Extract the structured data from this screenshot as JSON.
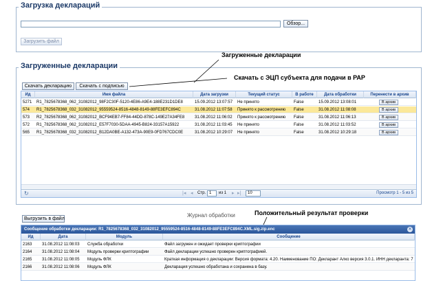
{
  "upload": {
    "legend": "Загрузка деклараций",
    "file_value": "",
    "browse_label": "Обзор...",
    "upload_label": "Загрузить файл"
  },
  "loaded": {
    "legend": "Загруженные декларации",
    "download_label": "Скачать декларацию",
    "download_signed_label": "Скачать с подписью",
    "columns": [
      "Ид",
      "Имя файла",
      "Дата загрузки",
      "Текущий статус",
      "В работе",
      "Дата обработки",
      "Перенести в архив"
    ],
    "rows": [
      [
        "5271",
        "R1_7825678368_062_31082012_98F2C30F-5120-4E86-A9E4-188E231D1DE8",
        "15.09.2012 13:07:57",
        "Не принято",
        "False",
        "15.09.2012 13:08:01",
        "В архив"
      ],
      [
        "574",
        "R1_7825678368_032_31082012_95559524-8516-4848-8149-88FE3EFC894C",
        "31.08.2012 11:07:58",
        "Принято к рассмотрению",
        "False",
        "31.08.2012 11:08:08",
        "В архив"
      ],
      [
        "573",
        "R2_7825678368_062_31082012_BCF94EB7-FF84-44DD-878C-149E27A34FE8",
        "31.08.2012 11:06:02",
        "Принято к рассмотрению",
        "False",
        "31.08.2012 11:06:13",
        "В архив"
      ],
      [
        "572",
        "R1_7825678368_062_31082012_E57F7030-5DAA-4945-B824-33157A15922",
        "31.08.2012 11:03:45",
        "Не принято",
        "False",
        "31.08.2012 11:03:52",
        "В архив"
      ],
      [
        "565",
        "R1_7825678368_032_31082012_B12DA0BE-A132-473A-90E9-0FD767CDC0E",
        "31.08.2012 10:29:07",
        "Не принято",
        "False",
        "31.08.2012 10:29:18",
        "В архив"
      ]
    ],
    "pager": {
      "page_label": "Стр.",
      "page_value": "1",
      "of_label": "из 1",
      "size_value": "10",
      "summary": "Просмотр 1 - 5 из 5"
    }
  },
  "annotations": {
    "loaded": "Загруженные декларации",
    "download_sign": "Скачать с ЭЦП субъекта для подачи в РАР",
    "positive": "Положительный результат проверки"
  },
  "log": {
    "export_label": "Выгрузить в файл",
    "title": "Журнал обработки",
    "header": "Сообщение обработки декларации: R1_7825678368_032_31082012_95559524-8516-4848-8149-88FE3EFC894C.XML.sig.zip.enc",
    "columns": [
      "Ид",
      "Дата",
      "Модуль",
      "Сообщение"
    ],
    "rows": [
      [
        "2163",
        "31.08.2012 11:08:03",
        "Служба обработки",
        "Файл загружен и ожидает проверки криптографии"
      ],
      [
        "2164",
        "31.08.2012 11:08:04",
        "Модуль проверки криптографии",
        "Файл декларации успешно проверен криптографией."
      ],
      [
        "2165",
        "31.08.2012 11:08:05",
        "Модуль ФЛК",
        "Краткая информация о декларации: Версия формата: 4.20. Наименование ПО: Декларант Алко версия 3.0.1. ИНН декларанта: 7"
      ],
      [
        "2166",
        "31.08.2012 11:08:06",
        "Модуль ФЛК",
        "Декларация успешно обработана и сохранена в базу."
      ]
    ]
  },
  "colors": {
    "selected_row": "#fbe89a",
    "header_text": "#15428b",
    "log_bar": "#2a569b"
  }
}
